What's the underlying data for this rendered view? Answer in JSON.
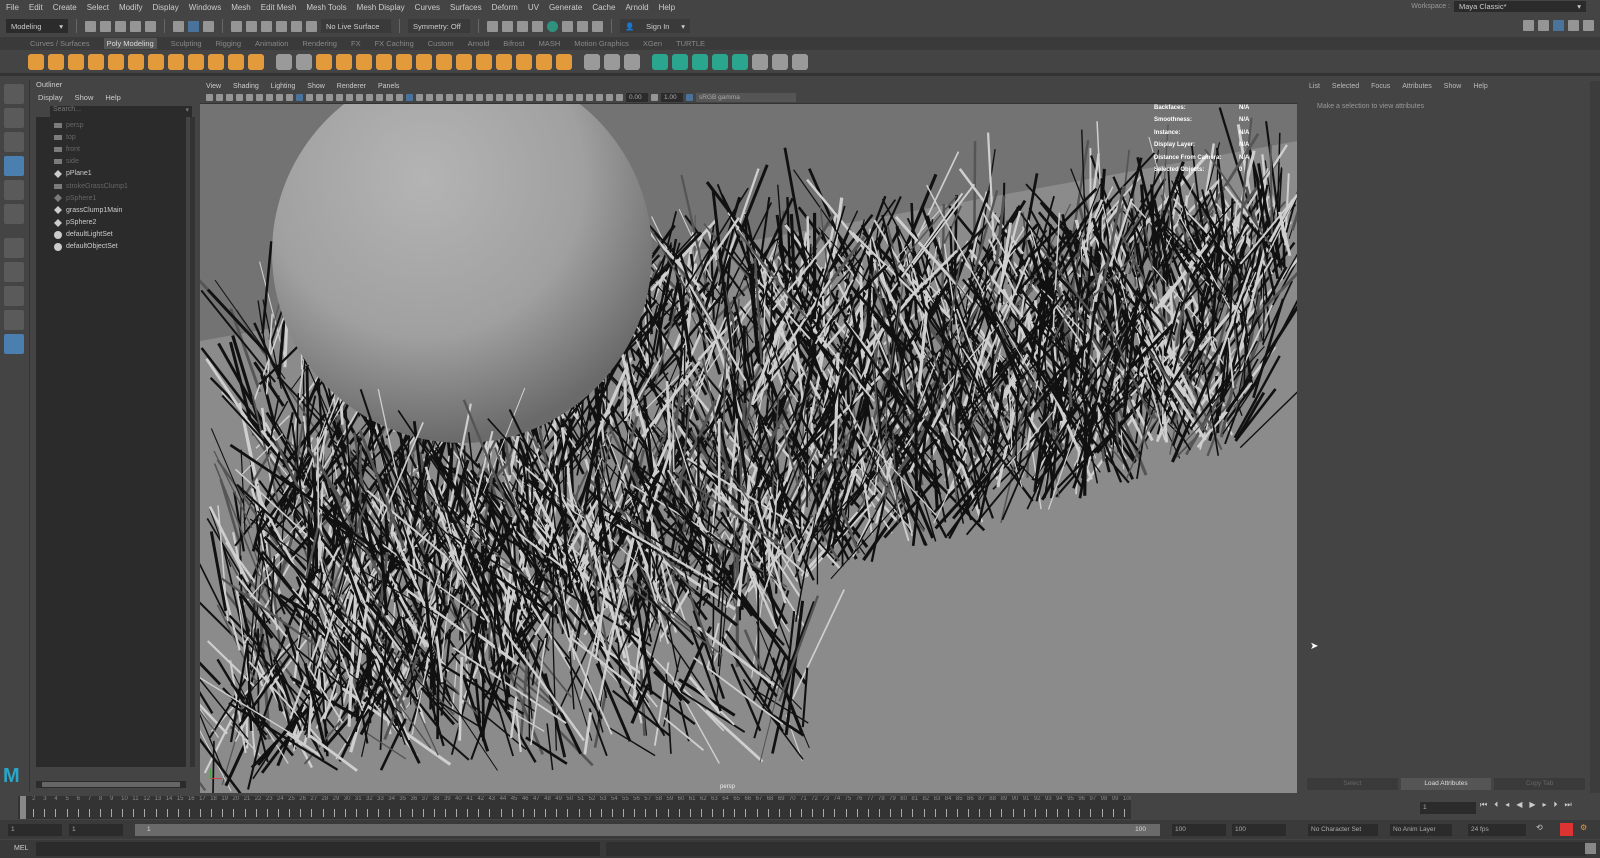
{
  "menubar": [
    "File",
    "Edit",
    "Create",
    "Select",
    "Modify",
    "Display",
    "Windows",
    "Mesh",
    "Edit Mesh",
    "Mesh Tools",
    "Mesh Display",
    "Curves",
    "Surfaces",
    "Deform",
    "UV",
    "Generate",
    "Cache",
    "Arnold",
    "Help"
  ],
  "workspace": {
    "label": "Workspace :",
    "value": "Maya Classic*"
  },
  "status": {
    "mode": "Modeling",
    "live_surface": "No Live Surface",
    "symmetry": "Symmetry: Off",
    "sign_in": "Sign In"
  },
  "shelf_tabs": [
    "Curves / Surfaces",
    "Poly Modeling",
    "Sculpting",
    "Rigging",
    "Animation",
    "Rendering",
    "FX",
    "FX Caching",
    "Custom",
    "Arnold",
    "Bifrost",
    "MASH",
    "Motion Graphics",
    "XGen",
    "TURTLE"
  ],
  "shelf_active": "Poly Modeling",
  "outliner": {
    "title": "Outliner",
    "menu": [
      "Display",
      "Show",
      "Help"
    ],
    "search_placeholder": "Search...",
    "items": [
      {
        "label": "persp",
        "type": "camera",
        "dim": true
      },
      {
        "label": "top",
        "type": "camera",
        "dim": true
      },
      {
        "label": "front",
        "type": "camera",
        "dim": true
      },
      {
        "label": "side",
        "type": "camera",
        "dim": true
      },
      {
        "label": "pPlane1",
        "type": "transform",
        "dim": false
      },
      {
        "label": "strokeGrassClump1",
        "type": "stroke",
        "dim": true
      },
      {
        "label": "pSphere1",
        "type": "transform",
        "dim": true
      },
      {
        "label": "grassClump1Main",
        "type": "transform",
        "dim": false
      },
      {
        "label": "pSphere2",
        "type": "transform",
        "dim": false
      },
      {
        "label": "defaultLightSet",
        "type": "set",
        "dim": false
      },
      {
        "label": "defaultObjectSet",
        "type": "set",
        "dim": false
      }
    ]
  },
  "viewport": {
    "menu": [
      "View",
      "Shading",
      "Lighting",
      "Show",
      "Renderer",
      "Panels"
    ],
    "exposure": "0.00",
    "gamma": "1.00",
    "color_space": "sRGB gamma",
    "camera": "persp",
    "hud": [
      {
        "k": "Backfaces:",
        "v": "N/A"
      },
      {
        "k": "Smoothness:",
        "v": "N/A"
      },
      {
        "k": "Instance:",
        "v": "N/A"
      },
      {
        "k": "Display Layer:",
        "v": "N/A"
      },
      {
        "k": "Distance From Camera:",
        "v": "N/A"
      },
      {
        "k": "Selected Objects:",
        "v": "0"
      }
    ]
  },
  "attribute_editor": {
    "menu": [
      "List",
      "Selected",
      "Focus",
      "Attributes",
      "Show",
      "Help"
    ],
    "message": "Make a selection to view attributes",
    "buttons": [
      "Select",
      "Load Attributes",
      "Copy Tab"
    ]
  },
  "timeline": {
    "start": 1,
    "end": 100,
    "current": "1"
  },
  "range": {
    "start": "1",
    "inner_start": "1",
    "slider_start": "1",
    "slider_end": "100",
    "inner_end": "100",
    "end": "100",
    "character_set": "No Character Set",
    "anim_layer": "No Anim Layer",
    "fps": "24 fps"
  },
  "cmd": {
    "label": "MEL"
  },
  "colors": {
    "accent": "#4b7fb0",
    "shelf_orange": "#e39a3b",
    "shelf_teal": "#2aa68f"
  }
}
